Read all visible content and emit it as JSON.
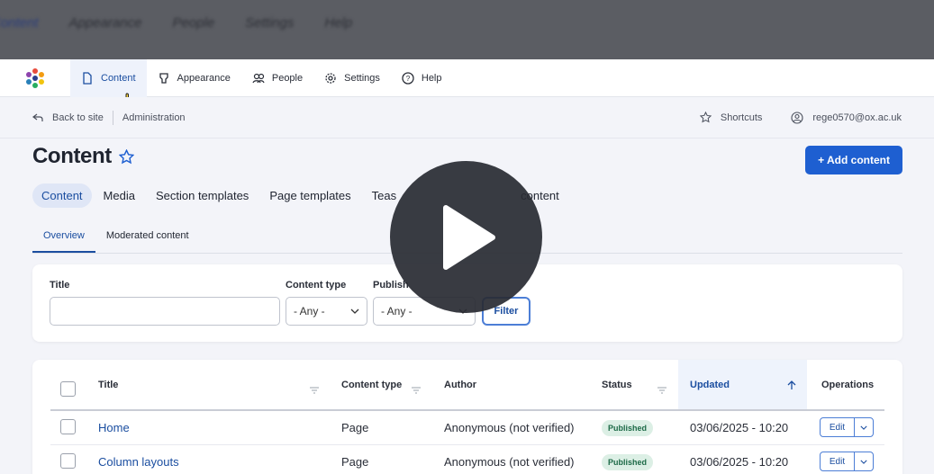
{
  "ghost_bar": {
    "items": [
      "Content",
      "Appearance",
      "People",
      "Settings",
      "Help"
    ]
  },
  "toolbar": {
    "items": [
      {
        "label": "Content",
        "icon": "document-icon"
      },
      {
        "label": "Appearance",
        "icon": "brush-icon"
      },
      {
        "label": "People",
        "icon": "people-icon"
      },
      {
        "label": "Settings",
        "icon": "gear-icon"
      },
      {
        "label": "Help",
        "icon": "help-icon"
      }
    ]
  },
  "subbar": {
    "back": "Back to site",
    "admin": "Administration",
    "shortcuts": "Shortcuts",
    "user": "rege0570@ox.ac.uk"
  },
  "page": {
    "title": "Content",
    "add_button": "+ Add content"
  },
  "primary_tabs": [
    "Content",
    "Media",
    "Section templates",
    "Page templates",
    "Teas",
    "content"
  ],
  "secondary_tabs": [
    "Overview",
    "Moderated content"
  ],
  "filters": {
    "title_label": "Title",
    "title_value": "",
    "content_type_label": "Content type",
    "content_type_value": "- Any -",
    "published_label": "Publish",
    "published_value": "- Any -",
    "filter_button": "Filter"
  },
  "table": {
    "columns": [
      "Title",
      "Content type",
      "Author",
      "Status",
      "Updated",
      "Operations"
    ],
    "rows": [
      {
        "title": "Home",
        "type": "Page",
        "author": "Anonymous (not verified)",
        "status": "Published",
        "updated": "03/06/2025 - 10:20",
        "op": "Edit"
      },
      {
        "title": "Column layouts",
        "type": "Page",
        "author": "Anonymous (not verified)",
        "status": "Published",
        "updated": "03/06/2025 - 10:20",
        "op": "Edit"
      }
    ]
  },
  "colors": {
    "accent": "#1e5fd1",
    "published_bg": "#dcefe5",
    "toolbar_active": "#eef2fb"
  }
}
